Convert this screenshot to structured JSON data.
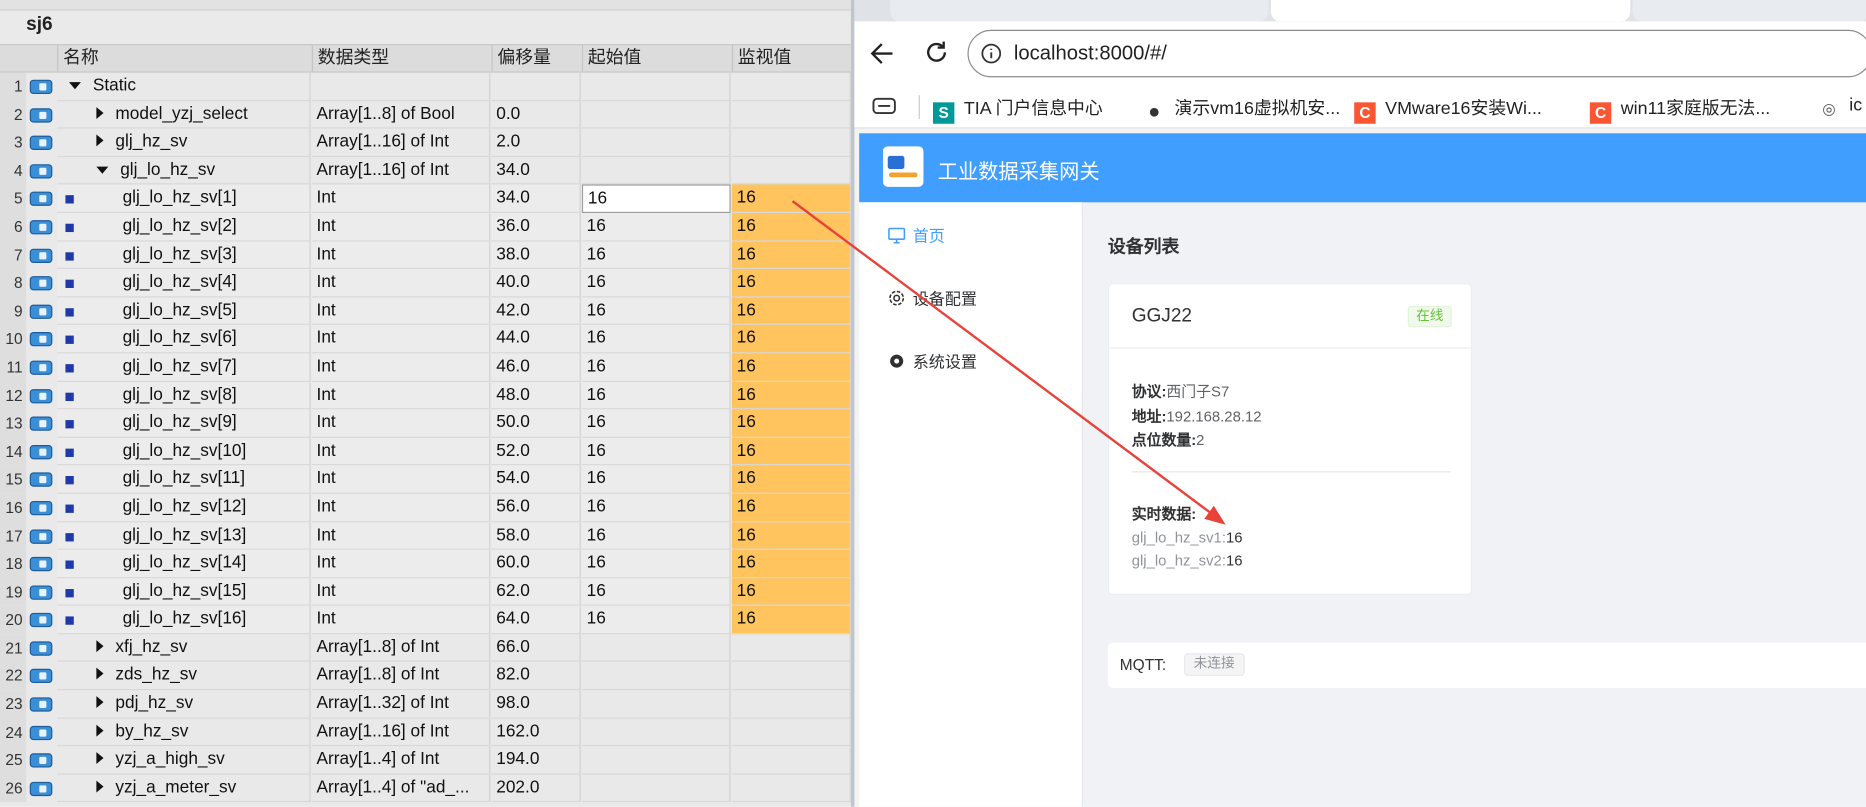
{
  "tia": {
    "block_title": "sj6",
    "columns": [
      "名称",
      "数据类型",
      "偏移量",
      "起始值",
      "监视值"
    ],
    "rows": [
      {
        "num": "1",
        "name": "Static",
        "type": "",
        "offset": "",
        "start": "",
        "monitor": "",
        "expander": "down",
        "level": 0
      },
      {
        "num": "2",
        "name": "model_yzj_select",
        "type": "Array[1..8] of Bool",
        "offset": "0.0",
        "start": "",
        "monitor": "",
        "expander": "right",
        "level": 1
      },
      {
        "num": "3",
        "name": "glj_hz_sv",
        "type": "Array[1..16] of Int",
        "offset": "2.0",
        "start": "",
        "monitor": "",
        "expander": "right",
        "level": 1
      },
      {
        "num": "4",
        "name": "glj_lo_hz_sv",
        "type": "Array[1..16] of Int",
        "offset": "34.0",
        "start": "",
        "monitor": "",
        "expander": "down",
        "level": 1
      },
      {
        "num": "5",
        "name": "glj_lo_hz_sv[1]",
        "type": "Int",
        "offset": "34.0",
        "start": "16",
        "monitor": "16",
        "expander": "",
        "level": 2
      },
      {
        "num": "6",
        "name": "glj_lo_hz_sv[2]",
        "type": "Int",
        "offset": "36.0",
        "start": "16",
        "monitor": "16",
        "expander": "",
        "level": 2
      },
      {
        "num": "7",
        "name": "glj_lo_hz_sv[3]",
        "type": "Int",
        "offset": "38.0",
        "start": "16",
        "monitor": "16",
        "expander": "",
        "level": 2
      },
      {
        "num": "8",
        "name": "glj_lo_hz_sv[4]",
        "type": "Int",
        "offset": "40.0",
        "start": "16",
        "monitor": "16",
        "expander": "",
        "level": 2
      },
      {
        "num": "9",
        "name": "glj_lo_hz_sv[5]",
        "type": "Int",
        "offset": "42.0",
        "start": "16",
        "monitor": "16",
        "expander": "",
        "level": 2
      },
      {
        "num": "10",
        "name": "glj_lo_hz_sv[6]",
        "type": "Int",
        "offset": "44.0",
        "start": "16",
        "monitor": "16",
        "expander": "",
        "level": 2
      },
      {
        "num": "11",
        "name": "glj_lo_hz_sv[7]",
        "type": "Int",
        "offset": "46.0",
        "start": "16",
        "monitor": "16",
        "expander": "",
        "level": 2
      },
      {
        "num": "12",
        "name": "glj_lo_hz_sv[8]",
        "type": "Int",
        "offset": "48.0",
        "start": "16",
        "monitor": "16",
        "expander": "",
        "level": 2
      },
      {
        "num": "13",
        "name": "glj_lo_hz_sv[9]",
        "type": "Int",
        "offset": "50.0",
        "start": "16",
        "monitor": "16",
        "expander": "",
        "level": 2
      },
      {
        "num": "14",
        "name": "glj_lo_hz_sv[10]",
        "type": "Int",
        "offset": "52.0",
        "start": "16",
        "monitor": "16",
        "expander": "",
        "level": 2
      },
      {
        "num": "15",
        "name": "glj_lo_hz_sv[11]",
        "type": "Int",
        "offset": "54.0",
        "start": "16",
        "monitor": "16",
        "expander": "",
        "level": 2
      },
      {
        "num": "16",
        "name": "glj_lo_hz_sv[12]",
        "type": "Int",
        "offset": "56.0",
        "start": "16",
        "monitor": "16",
        "expander": "",
        "level": 2
      },
      {
        "num": "17",
        "name": "glj_lo_hz_sv[13]",
        "type": "Int",
        "offset": "58.0",
        "start": "16",
        "monitor": "16",
        "expander": "",
        "level": 2
      },
      {
        "num": "18",
        "name": "glj_lo_hz_sv[14]",
        "type": "Int",
        "offset": "60.0",
        "start": "16",
        "monitor": "16",
        "expander": "",
        "level": 2
      },
      {
        "num": "19",
        "name": "glj_lo_hz_sv[15]",
        "type": "Int",
        "offset": "62.0",
        "start": "16",
        "monitor": "16",
        "expander": "",
        "level": 2
      },
      {
        "num": "20",
        "name": "glj_lo_hz_sv[16]",
        "type": "Int",
        "offset": "64.0",
        "start": "16",
        "monitor": "16",
        "expander": "",
        "level": 2
      },
      {
        "num": "21",
        "name": "xfj_hz_sv",
        "type": "Array[1..8] of Int",
        "offset": "66.0",
        "start": "",
        "monitor": "",
        "expander": "right",
        "level": 1
      },
      {
        "num": "22",
        "name": "zds_hz_sv",
        "type": "Array[1..8] of Int",
        "offset": "82.0",
        "start": "",
        "monitor": "",
        "expander": "right",
        "level": 1
      },
      {
        "num": "23",
        "name": "pdj_hz_sv",
        "type": "Array[1..32] of Int",
        "offset": "98.0",
        "start": "",
        "monitor": "",
        "expander": "right",
        "level": 1
      },
      {
        "num": "24",
        "name": "by_hz_sv",
        "type": "Array[1..16] of Int",
        "offset": "162.0",
        "start": "",
        "monitor": "",
        "expander": "right",
        "level": 1
      },
      {
        "num": "25",
        "name": "yzj_a_high_sv",
        "type": "Array[1..4] of Int",
        "offset": "194.0",
        "start": "",
        "monitor": "",
        "expander": "right",
        "level": 1
      },
      {
        "num": "26",
        "name": "yzj_a_meter_sv",
        "type": "Array[1..4] of \"ad_...",
        "offset": "202.0",
        "start": "",
        "monitor": "",
        "expander": "right",
        "level": 1
      }
    ]
  },
  "browser": {
    "url": "localhost:8000/#/",
    "bookmarks": [
      {
        "label": "TIA 门户信息中心",
        "icon": "siemens-icon",
        "color": "#009999",
        "glyph": "S"
      },
      {
        "label": "演示vm16虚拟机安...",
        "icon": "globe-dark-icon",
        "color": "#333333",
        "glyph": "●"
      },
      {
        "label": "VMware16安装Wi...",
        "icon": "csdn-icon",
        "color": "#fc5531",
        "glyph": "C"
      },
      {
        "label": "win11家庭版无法...",
        "icon": "csdn-icon",
        "color": "#fc5531",
        "glyph": "C"
      },
      {
        "label": "ic",
        "icon": "globe-icon",
        "color": "#555555",
        "glyph": "◎"
      }
    ]
  },
  "app": {
    "title": "工业数据采集网关",
    "menu": [
      {
        "label": "首页",
        "icon": "monitor-icon",
        "active": true
      },
      {
        "label": "设备配置",
        "icon": "gear-icon",
        "active": false
      },
      {
        "label": "系统设置",
        "icon": "settings-icon",
        "active": false
      }
    ],
    "page_title": "设备列表",
    "device": {
      "name": "GGJ22",
      "status": "在线",
      "protocol_label": "协议:",
      "protocol": "西门子S7",
      "address_label": "地址:",
      "address": "192.168.28.12",
      "points_label": "点位数量:",
      "points": "2",
      "realtime_label": "实时数据:",
      "realtime": [
        {
          "name": "glj_lo_hz_sv1:",
          "value": "16"
        },
        {
          "name": "glj_lo_hz_sv2:",
          "value": "16"
        }
      ]
    },
    "mqtt_label": "MQTT:",
    "mqtt_status": "未连接"
  },
  "colors": {
    "accent": "#409eff",
    "monitor_bg": "#ffc45d",
    "arrow": "#e8423a",
    "online": "#67c23a"
  }
}
